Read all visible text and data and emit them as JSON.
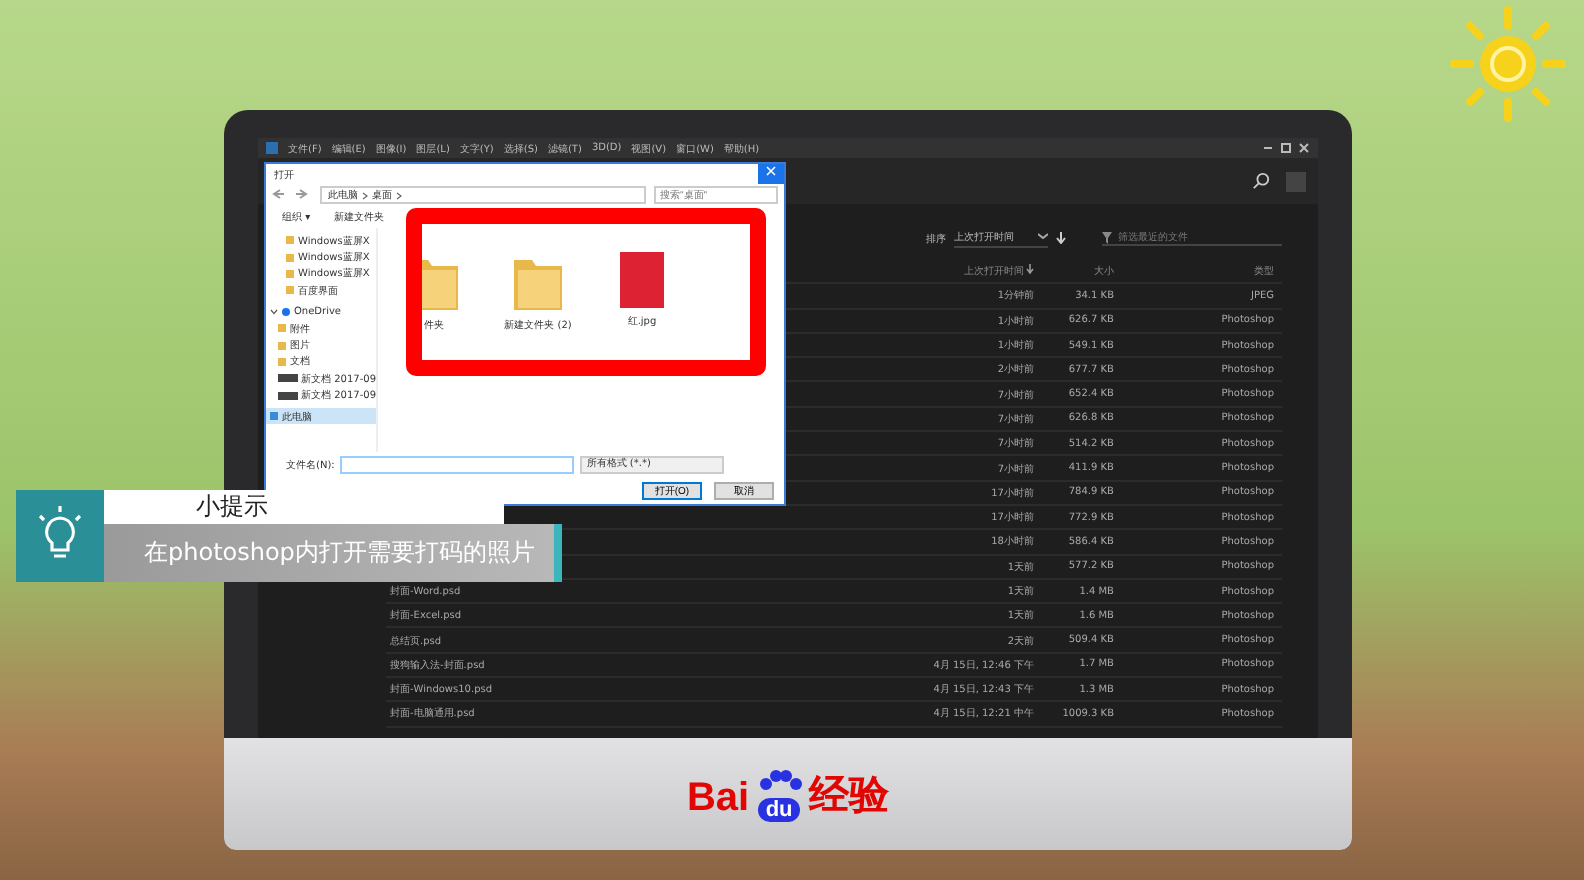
{
  "ps": {
    "menu": [
      "文件(F)",
      "编辑(E)",
      "图像(I)",
      "图层(L)",
      "文字(Y)",
      "选择(S)",
      "滤镜(T)",
      "3D(D)",
      "视图(V)",
      "窗口(W)",
      "帮助(H)"
    ],
    "sort": {
      "label": "排序",
      "value": "上次打开时间"
    },
    "filter": {
      "placeholder": "筛选最近的文件"
    },
    "columns": [
      "上次打开时间",
      "大小",
      "类型"
    ],
    "rows": [
      {
        "time": "1分钟前",
        "size": "34.1 KB",
        "type": "JPEG"
      },
      {
        "time": "1小时前",
        "size": "626.7 KB",
        "type": "Photoshop"
      },
      {
        "time": "1小时前",
        "size": "549.1 KB",
        "type": "Photoshop"
      },
      {
        "time": "2小时前",
        "size": "677.7 KB",
        "type": "Photoshop"
      },
      {
        "time": "7小时前",
        "size": "652.4 KB",
        "type": "Photoshop"
      },
      {
        "time": "7小时前",
        "size": "626.8 KB",
        "type": "Photoshop"
      },
      {
        "time": "7小时前",
        "size": "514.2 KB",
        "type": "Photoshop"
      },
      {
        "time": "7小时前",
        "size": "411.9 KB",
        "type": "Photoshop"
      },
      {
        "time": "17小时前",
        "size": "784.9 KB",
        "type": "Photoshop"
      },
      {
        "time": "17小时前",
        "size": "772.9 KB",
        "type": "Photoshop"
      },
      {
        "time": "18小时前",
        "size": "586.4 KB",
        "type": "Photoshop"
      },
      {
        "time": "1天前",
        "size": "577.2 KB",
        "type": "Photoshop"
      },
      {
        "name": "封面-Word.psd",
        "time": "1天前",
        "size": "1.4 MB",
        "type": "Photoshop"
      },
      {
        "name": "封面-Excel.psd",
        "time": "1天前",
        "size": "1.6 MB",
        "type": "Photoshop"
      },
      {
        "name": "总结页.psd",
        "time": "2天前",
        "size": "509.4 KB",
        "type": "Photoshop"
      },
      {
        "name": "搜狗输入法-封面.psd",
        "time": "4月 15日, 12:46 下午",
        "size": "1.7 MB",
        "type": "Photoshop"
      },
      {
        "name": "封面-Windows10.psd",
        "time": "4月 15日, 12:43 下午",
        "size": "1.3 MB",
        "type": "Photoshop"
      },
      {
        "name": "封面-电脑通用.psd",
        "time": "4月 15日, 12:21 中午",
        "size": "1009.3 KB",
        "type": "Photoshop"
      }
    ]
  },
  "dialog": {
    "title": "打开",
    "path": [
      "此电脑",
      "桌面"
    ],
    "search": {
      "placeholder": "搜索\"桌面\""
    },
    "toolbar": [
      "组织 ▾",
      "新建文件夹"
    ],
    "nav": [
      {
        "label": "Windows蓝屏X",
        "kind": "folder",
        "selected": false
      },
      {
        "label": "Windows蓝屏X",
        "kind": "folder",
        "selected": false
      },
      {
        "label": "Windows蓝屏X",
        "kind": "folder",
        "selected": false
      },
      {
        "label": "百度界面",
        "kind": "folder",
        "selected": false
      },
      {
        "label": "OneDrive",
        "kind": "cloud",
        "selected": false,
        "expanded": true,
        "children": [
          {
            "label": "附件",
            "kind": "folder",
            "selected": false
          },
          {
            "label": "图片",
            "kind": "folder",
            "selected": false
          },
          {
            "label": "文档",
            "kind": "folder",
            "selected": false
          },
          {
            "label": "新文档 2017-09",
            "kind": "file",
            "selected": false
          },
          {
            "label": "新文档 2017-09",
            "kind": "file",
            "selected": false
          }
        ]
      },
      {
        "label": "此电脑",
        "kind": "pc",
        "selected": true
      }
    ],
    "files": [
      {
        "label": "件夹",
        "kind": "folder"
      },
      {
        "label": "新建文件夹 (2)",
        "kind": "folder"
      },
      {
        "label": "红.jpg",
        "kind": "photo"
      }
    ],
    "filename_label": "文件名(N):",
    "filetype": "所有格式 (*.*)",
    "buttons": [
      "打开(O)",
      "取消"
    ]
  },
  "tip": {
    "title": "小提示",
    "text": "在photoshop内打开需要打码的照片"
  },
  "brand": {
    "left": "Bai",
    "mid": "du",
    "right": "经验"
  }
}
